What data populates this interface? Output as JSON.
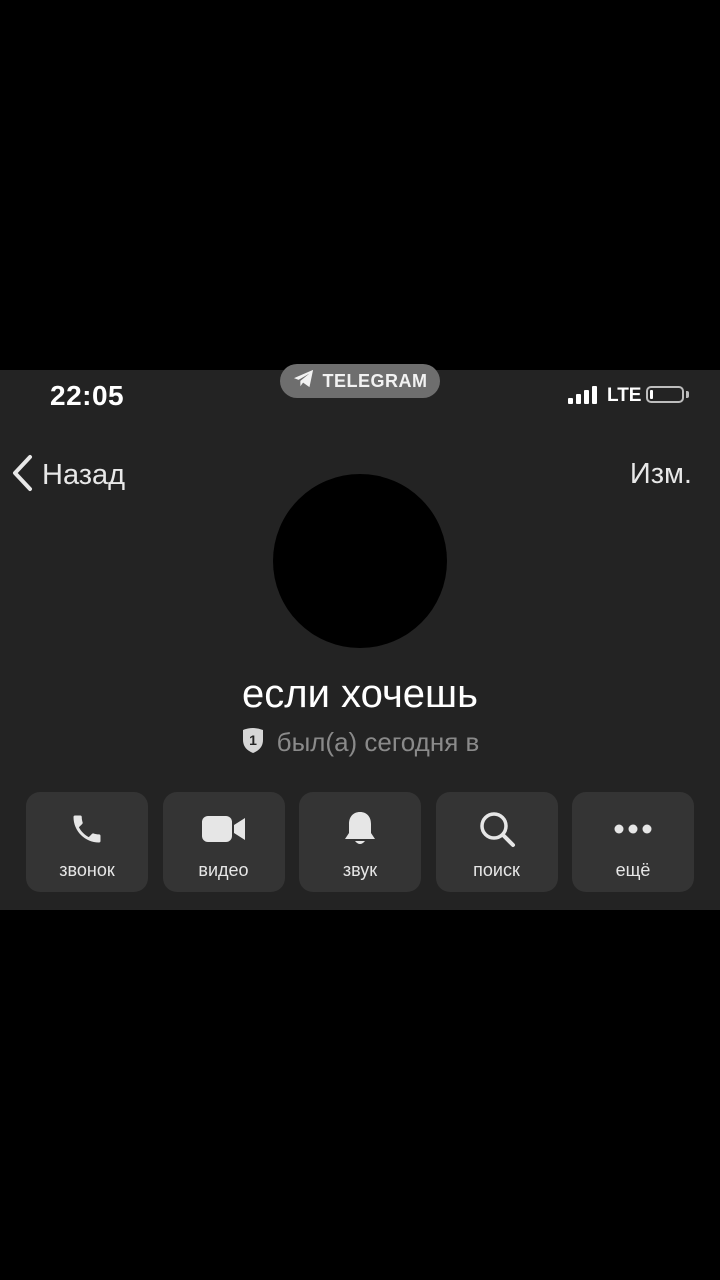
{
  "status_bar": {
    "time": "22:05",
    "app_label": "TELEGRAM",
    "network": "LTE",
    "battery_level": 0.1
  },
  "nav": {
    "back_label": "Назад",
    "edit_label": "Изм."
  },
  "profile": {
    "name": "если хочешь",
    "badge_number": "1",
    "last_seen": "был(а) сегодня в"
  },
  "actions": [
    {
      "label": "звонок",
      "icon": "phone-icon"
    },
    {
      "label": "видео",
      "icon": "video-icon"
    },
    {
      "label": "звук",
      "icon": "bell-icon"
    },
    {
      "label": "поиск",
      "icon": "search-icon"
    },
    {
      "label": "ещё",
      "icon": "more-icon"
    }
  ],
  "colors": {
    "page_background": "#000000",
    "screen_background": "#232323",
    "button_background": "#343434",
    "muted_text": "#8a8a8a"
  }
}
